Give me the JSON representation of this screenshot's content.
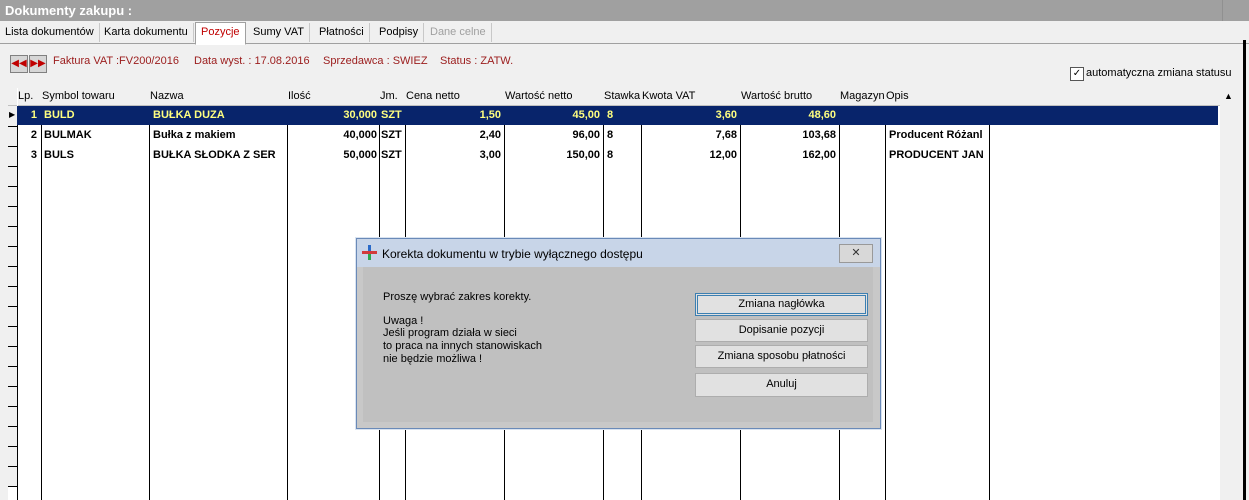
{
  "window": {
    "title": "Dokumenty zakupu :"
  },
  "tabs": [
    {
      "label": "Lista dokumentów"
    },
    {
      "label": "Karta dokumentu"
    },
    {
      "label": "Pozycje"
    },
    {
      "label": "Sumy VAT"
    },
    {
      "label": "Płatności"
    },
    {
      "label": "Podpisy"
    },
    {
      "label": "Dane celne"
    }
  ],
  "info": {
    "invoice": "Faktura VAT :FV200/2016",
    "date": "Data wyst. : 17.08.2016",
    "seller": "Sprzedawca : SWIEZ",
    "status": "Status : ZATW."
  },
  "auto_status_label": "automatyczna zmiana statusu",
  "auto_status_checked": true,
  "columns": [
    "Lp.",
    "Symbol towaru",
    "Nazwa",
    "Ilość",
    "Jm.",
    "Cena netto",
    "Wartość netto",
    "Stawka",
    "Kwota VAT",
    "Wartość brutto",
    "Magazyn",
    "Opis"
  ],
  "rows": [
    {
      "lp": "1",
      "symbol": "BULD",
      "nazwa": "BUŁKA DUZA",
      "ilosc": "30,000",
      "jm": "SZT",
      "cena": "1,50",
      "netto": "45,00",
      "stawka": "8",
      "vat": "3,60",
      "brutto": "48,60",
      "magazyn": "",
      "opis": ""
    },
    {
      "lp": "2",
      "symbol": "BULMAK",
      "nazwa": "Bułka z makiem",
      "ilosc": "40,000",
      "jm": "SZT",
      "cena": "2,40",
      "netto": "96,00",
      "stawka": "8",
      "vat": "7,68",
      "brutto": "103,68",
      "magazyn": "",
      "opis": "Producent Różanl"
    },
    {
      "lp": "3",
      "symbol": "BULS",
      "nazwa": "BUŁKA SŁODKA Z SER",
      "ilosc": "50,000",
      "jm": "SZT",
      "cena": "3,00",
      "netto": "150,00",
      "stawka": "8",
      "vat": "12,00",
      "brutto": "162,00",
      "magazyn": "",
      "opis": "PRODUCENT JAN"
    }
  ],
  "dialog": {
    "title": "Korekta dokumentu w trybie wyłącznego dostępu",
    "prompt": "Proszę wybrać zakres korekty.",
    "warning": [
      "Uwaga !",
      "Jeśli program działa w sieci",
      "to praca na innych stanowiskach",
      "nie będzie możliwa !"
    ],
    "buttons": [
      "Zmiana nagłówka",
      "Dopisanie pozycji",
      "Zmiana sposobu płatności",
      "Anuluj"
    ],
    "close_label": "✕"
  },
  "colors": {
    "selection": "#08246b",
    "selection_text": "#ffff80",
    "accent_text": "#9b1c1c"
  }
}
